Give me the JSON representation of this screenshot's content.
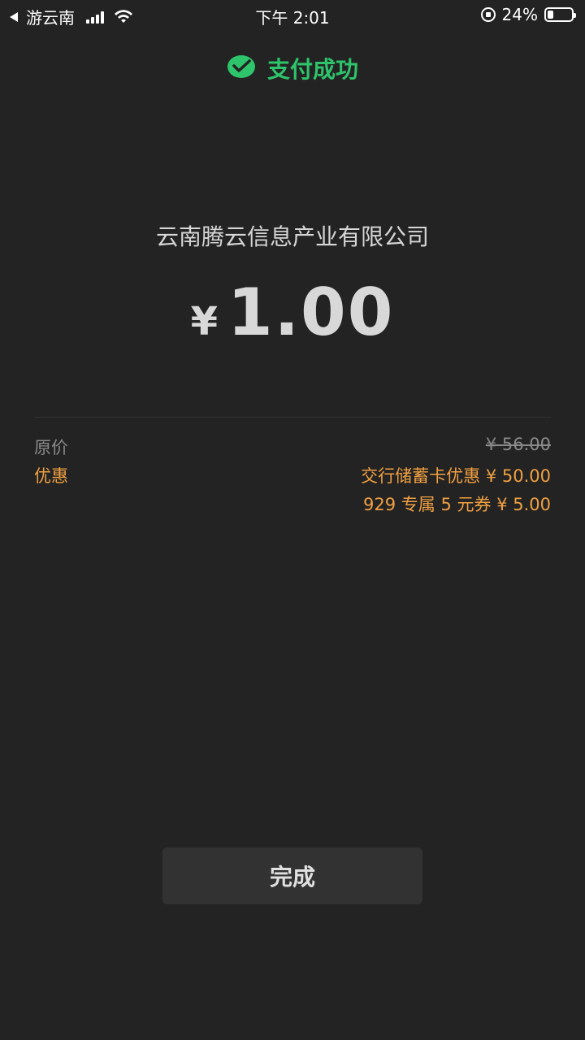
{
  "status_bar": {
    "carrier": "游云南",
    "time": "下午 2:01",
    "battery": "24%",
    "battery_level": 0.24,
    "icons": [
      "back-arrow-icon",
      "signal-icon",
      "wifi-icon",
      "orientation-lock-icon",
      "battery-icon"
    ]
  },
  "header": {
    "title": "支付成功",
    "icon": "wechat-pay-check-icon",
    "accent_color": "#2ec46b"
  },
  "payment": {
    "merchant": "云南腾云信息产业有限公司",
    "currency": "¥",
    "amount": "1.00"
  },
  "details": {
    "original_label": "原价",
    "original_value": "¥ 56.00",
    "discount_label": "优惠",
    "discounts": [
      "交行储蓄卡优惠 ¥ 50.00",
      "929 专属 5 元券 ¥ 5.00"
    ],
    "discount_color": "#f0a042"
  },
  "actions": {
    "done_label": "完成"
  }
}
